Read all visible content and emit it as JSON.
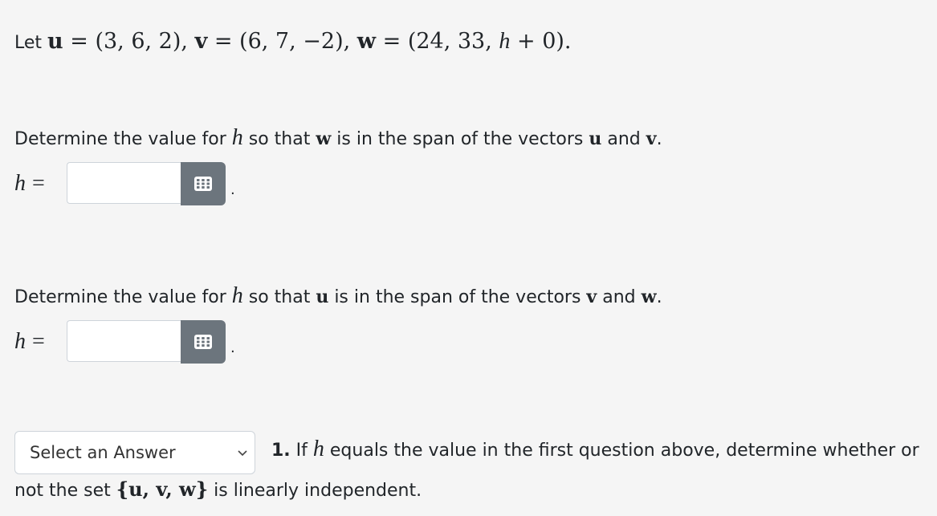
{
  "intro": {
    "prefix": "Let ",
    "u_label": "u",
    "u_value": " = (3, 6, 2), ",
    "v_label": "v",
    "v_value": " = (6, 7, −2), ",
    "w_label": "w",
    "w_value": " = (24, 33, ",
    "h_var": "h",
    "w_tail": " + 0)."
  },
  "question1": {
    "text_a": "Determine the value for ",
    "h_var": "h",
    "text_b": " so that ",
    "w": "w",
    "text_c": " is in the span of the vectors ",
    "u": "u",
    "text_d": " and ",
    "v": "v",
    "text_e": ".",
    "answer_label_var": "h",
    "answer_label_eq": "=",
    "answer_value": "",
    "period": "."
  },
  "question2": {
    "text_a": "Determine the value for ",
    "h_var": "h",
    "text_b": " so that ",
    "u": "u",
    "text_c": " is in the span of the vectors ",
    "v": "v",
    "text_d": " and ",
    "w": "w",
    "text_e": ".",
    "answer_label_var": "h",
    "answer_label_eq": "=",
    "answer_value": "",
    "period": "."
  },
  "question3": {
    "select_value": "Select an Answer",
    "number": "1.",
    "text_a": " If ",
    "h_var": "h",
    "text_b": " equals the value in the first question above, determine whether or",
    "line2_a": "not the set ",
    "set": "{u, v, w}",
    "line2_b": " is linearly independent."
  },
  "icons": {
    "keyboard": "keyboard-icon",
    "chevron": "chevron-down-icon"
  }
}
